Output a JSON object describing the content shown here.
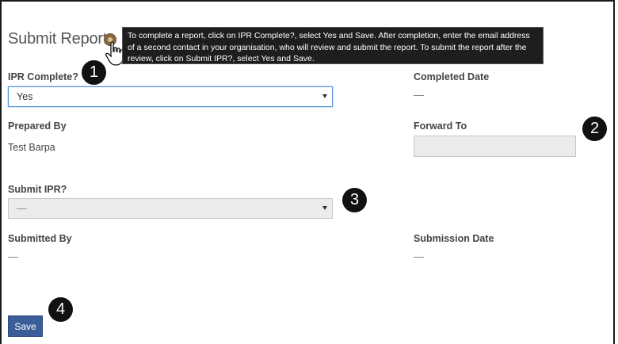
{
  "page": {
    "title": "Submit Report",
    "tooltip_text": "To complete a report, click on IPR Complete?, select Yes and Save. After completion, enter the email address of a second contact in your organisation, who will review and submit the report. To submit the report after the review, click on Submit IPR?, select Yes and Save."
  },
  "form": {
    "ipr_complete": {
      "label": "IPR Complete?",
      "value": "Yes"
    },
    "completed_date": {
      "label": "Completed Date",
      "value": "—"
    },
    "prepared_by": {
      "label": "Prepared By",
      "value": "Test Barpa"
    },
    "forward_to": {
      "label": "Forward To",
      "value": ""
    },
    "submit_ipr": {
      "label": "Submit IPR?",
      "value": "—"
    },
    "submitted_by": {
      "label": "Submitted By",
      "value": "—"
    },
    "submission_date": {
      "label": "Submission Date",
      "value": "—"
    },
    "save_label": "Save"
  },
  "callouts": [
    "1",
    "2",
    "3",
    "4"
  ],
  "icons": {
    "help": "help-icon",
    "cursor": "hand-pointer-icon",
    "caret": "chevron-down-icon"
  },
  "colors": {
    "accent": "#4a90d9",
    "button": "#3b5d9a",
    "tooltip_bg": "#1e1e1e",
    "callout_bg": "#111111"
  }
}
